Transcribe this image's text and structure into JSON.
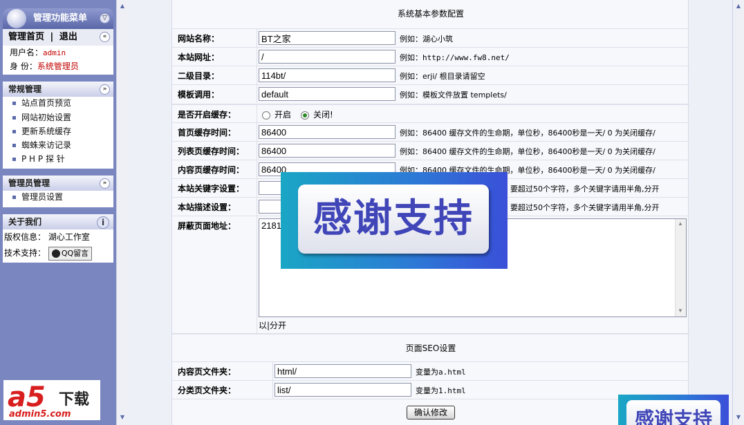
{
  "sidebar": {
    "header_title": "管理功能菜单",
    "home_link": "管理首页",
    "separator": "|",
    "logout_link": "退出",
    "username_label": "用户名：",
    "username_value": "admin",
    "role_label": "身 份：",
    "role_value": "系统管理员",
    "sections": [
      {
        "title": "常规管理",
        "items": [
          "站点首页预览",
          "网站初始设置",
          "更新系统缓存",
          "蜘蛛来访记录",
          "P H P 探 针"
        ]
      },
      {
        "title": "管理员管理",
        "items": [
          "管理员设置"
        ]
      }
    ],
    "about": {
      "title": "关于我们",
      "copyright_label": "版权信息：",
      "copyright_value": "湖心工作室",
      "support_label": "技术支持：",
      "qq_button": "QQ留言"
    },
    "logo": {
      "brand": "a5",
      "suffix": "下载",
      "url": "admin5.com"
    }
  },
  "form": {
    "section_title": "系统基本参数配置",
    "rows": [
      {
        "label": "网站名称：",
        "value": "BT之家",
        "hint": "例如：湖心小筑"
      },
      {
        "label": "本站网址：",
        "value": "/",
        "hint": "例如：http://www.fw8.net/"
      },
      {
        "label": "二级目录：",
        "value": "114bt/",
        "hint": "例如：erji/ 根目录请留空"
      },
      {
        "label": "模板调用：",
        "value": "default",
        "hint": "例如：模板文件放置 templets/"
      }
    ],
    "cache": {
      "label": "是否开启缓存：",
      "option_on": "开启",
      "option_off": "关闭!",
      "selected": "关闭!"
    },
    "cache_rows": [
      {
        "label": "首页缓存时间：",
        "value": "86400",
        "hint": "例如：86400 缓存文件的生命期，单位秒，86400秒是一天/ 0 为关闭缓存/"
      },
      {
        "label": "列表页缓存时间：",
        "value": "86400",
        "hint": "例如：86400 缓存文件的生命期，单位秒，86400秒是一天/ 0 为关闭缓存/"
      },
      {
        "label": "内容页缓存时间：",
        "value": "86400",
        "hint": "例如：86400 缓存文件的生命期，单位秒，86400秒是一天/ 0 为关闭缓存/"
      }
    ],
    "keyword_rows": [
      {
        "label": "本站关键字设置：",
        "value": "",
        "hint": "要超过50个字符，多个关键字请用半角,分开"
      },
      {
        "label": "本站描述设置：",
        "value": "",
        "hint": "要超过50个字符，多个关键字请用半角,分开"
      }
    ],
    "blocked": {
      "label": "屏蔽页面地址：",
      "value": "2181",
      "hint": "以|分开"
    },
    "seo_title": "页面SEO设置",
    "seo_rows": [
      {
        "label": "内容页文件夹：",
        "value": "html/",
        "hint": "变量为a.html"
      },
      {
        "label": "分类页文件夹：",
        "value": "list/",
        "hint": "变量为1.html"
      }
    ],
    "submit": "确认修改"
  },
  "overlay": {
    "text": "感谢支持"
  }
}
